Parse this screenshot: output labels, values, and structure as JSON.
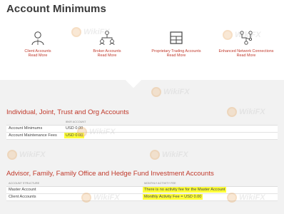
{
  "page": {
    "title": "Account Minimums"
  },
  "tiles": [
    {
      "label": "Client Accounts",
      "more": "Read More",
      "icon": "person-icon"
    },
    {
      "label": "Broker Accounts",
      "more": "Read More",
      "icon": "people-network-icon"
    },
    {
      "label": "Proprietary Trading Accounts",
      "more": "Read More",
      "icon": "grid-window-icon"
    },
    {
      "label": "Enhanced Network Connections",
      "more": "Read More",
      "icon": "network-nodes-icon"
    }
  ],
  "section1": {
    "title": "Individual, Joint, Trust and Org Accounts",
    "col_header": "IBKR ACCOUNT",
    "rows": [
      {
        "label": "Account Minimums",
        "value": "USD 0.00"
      },
      {
        "label": "Account Maintenance Fees",
        "value": "USD 0.00"
      }
    ]
  },
  "section2": {
    "title": "Advisor, Family, Family Office and Hedge Fund Investment Accounts",
    "headers": [
      "ACCOUNT STRUCTURE",
      "MONTHLY ACTIVITY FEE"
    ],
    "rows": [
      {
        "label": "Master Account",
        "value": "There is no activity fee for the Master Account"
      },
      {
        "label": "Client Accounts",
        "value": "Monthly Activity Fee = USD 0.00"
      }
    ]
  },
  "watermark": "WikiFX",
  "colors": {
    "accent": "#c0392b",
    "highlight": "#ffff3a",
    "panel": "#f2f2f2"
  }
}
